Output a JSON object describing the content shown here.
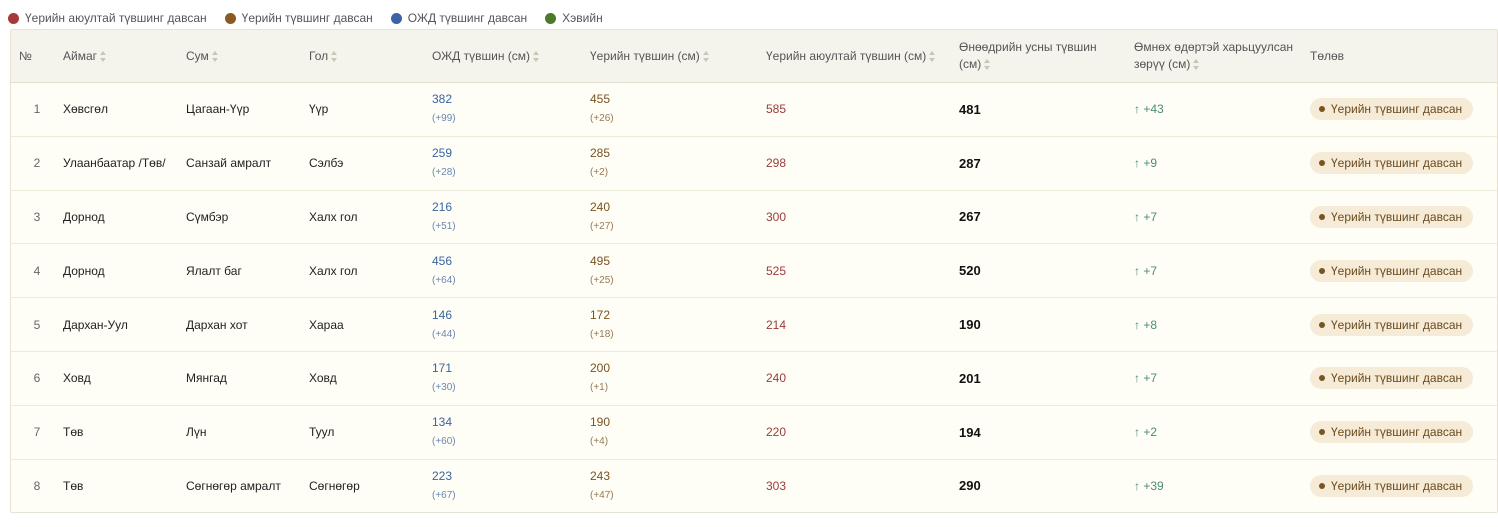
{
  "legend": [
    {
      "label": "Үерийн аюултай түвшинг давсан",
      "color": "#a63a3a"
    },
    {
      "label": "Үерийн түвшинг давсан",
      "color": "#8b5a22"
    },
    {
      "label": "ОЖД түвшинг давсан",
      "color": "#3b63a8"
    },
    {
      "label": "Хэвийн",
      "color": "#4a7a2a"
    }
  ],
  "columns": {
    "idx": "№",
    "aimag": "Аймаг",
    "sum": "Сум",
    "river": "Гол",
    "ojd": "ОЖД түвшин (см)",
    "flood": "Үерийн түвшин (см)",
    "danger": "Үерийн аюултай түвшин (см)",
    "today_1": "Өнөөдрийн усны түвшин",
    "today_2": "(см)",
    "change_1": "Өмнөх өдөртэй харьцуулсан",
    "change_2": "зөрүү (см)",
    "status": "Төлөв"
  },
  "rows": [
    {
      "idx": "1",
      "aimag": "Хөвсгөл",
      "sum": "Цагаан-Үүр",
      "river": "Үүр",
      "ojd": "382",
      "ojd_diff": "(+99)",
      "flood": "455",
      "flood_diff": "(+26)",
      "danger": "585",
      "today": "481",
      "change": "↑ +43",
      "status": "Үерийн түвшинг давсан"
    },
    {
      "idx": "2",
      "aimag": "Улаанбаатар /Төв/",
      "sum": "Санзай амралт",
      "river": "Сэлбэ",
      "ojd": "259",
      "ojd_diff": "(+28)",
      "flood": "285",
      "flood_diff": "(+2)",
      "danger": "298",
      "today": "287",
      "change": "↑ +9",
      "status": "Үерийн түвшинг давсан"
    },
    {
      "idx": "3",
      "aimag": "Дорнод",
      "sum": "Сүмбэр",
      "river": "Халх гол",
      "ojd": "216",
      "ojd_diff": "(+51)",
      "flood": "240",
      "flood_diff": "(+27)",
      "danger": "300",
      "today": "267",
      "change": "↑ +7",
      "status": "Үерийн түвшинг давсан"
    },
    {
      "idx": "4",
      "aimag": "Дорнод",
      "sum": "Ялалт баг",
      "river": "Халх гол",
      "ojd": "456",
      "ojd_diff": "(+64)",
      "flood": "495",
      "flood_diff": "(+25)",
      "danger": "525",
      "today": "520",
      "change": "↑ +7",
      "status": "Үерийн түвшинг давсан"
    },
    {
      "idx": "5",
      "aimag": "Дархан-Уул",
      "sum": "Дархан хот",
      "river": "Хараа",
      "ojd": "146",
      "ojd_diff": "(+44)",
      "flood": "172",
      "flood_diff": "(+18)",
      "danger": "214",
      "today": "190",
      "change": "↑ +8",
      "status": "Үерийн түвшинг давсан"
    },
    {
      "idx": "6",
      "aimag": "Ховд",
      "sum": "Мянгад",
      "river": "Ховд",
      "ojd": "171",
      "ojd_diff": "(+30)",
      "flood": "200",
      "flood_diff": "(+1)",
      "danger": "240",
      "today": "201",
      "change": "↑ +7",
      "status": "Үерийн түвшинг давсан"
    },
    {
      "idx": "7",
      "aimag": "Төв",
      "sum": "Лүн",
      "river": "Туул",
      "ojd": "134",
      "ojd_diff": "(+60)",
      "flood": "190",
      "flood_diff": "(+4)",
      "danger": "220",
      "today": "194",
      "change": "↑ +2",
      "status": "Үерийн түвшинг давсан"
    },
    {
      "idx": "8",
      "aimag": "Төв",
      "sum": "Сөгнөгөр амралт",
      "river": "Сөгнөгөр",
      "ojd": "223",
      "ojd_diff": "(+67)",
      "flood": "243",
      "flood_diff": "(+47)",
      "danger": "303",
      "today": "290",
      "change": "↑ +39",
      "status": "Үерийн түвшинг давсан"
    }
  ]
}
